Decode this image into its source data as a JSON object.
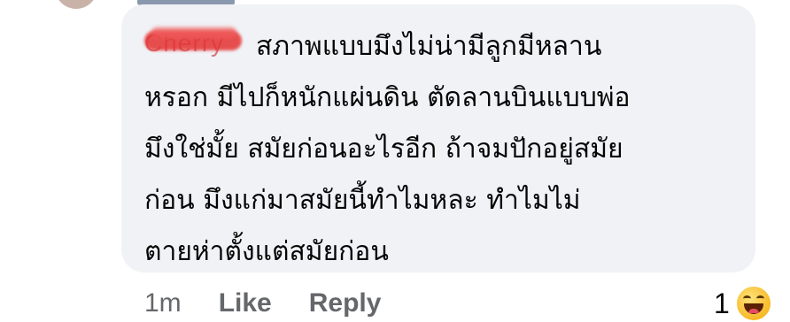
{
  "comment": {
    "author_name": "Cherry",
    "lines": [
      "สภาพแบบมึงไม่น่ามีลูกมีหลาน",
      "หรอก มีไปก็หนักแผ่นดิน ตัดลานบินแบบพ่อ",
      "มึงใช่มั้ย สมัยก่อนอะไรอีก ถ้าจมปักอยู่สมัย",
      "ก่อน มึงแก่มาสมัยนี้ทำไมหละ ทำไมไม่",
      "ตายห่าตั้งแต่สมัยก่อน"
    ]
  },
  "actions": {
    "time": "1m",
    "like_label": "Like",
    "reply_label": "Reply"
  },
  "reactions": {
    "count": "1",
    "icon": "haha-reaction-icon"
  },
  "colors": {
    "bubble_bg": "#f0f2f5",
    "meta_text": "#65676b",
    "body_text": "#050505",
    "redaction": "#e53232"
  }
}
